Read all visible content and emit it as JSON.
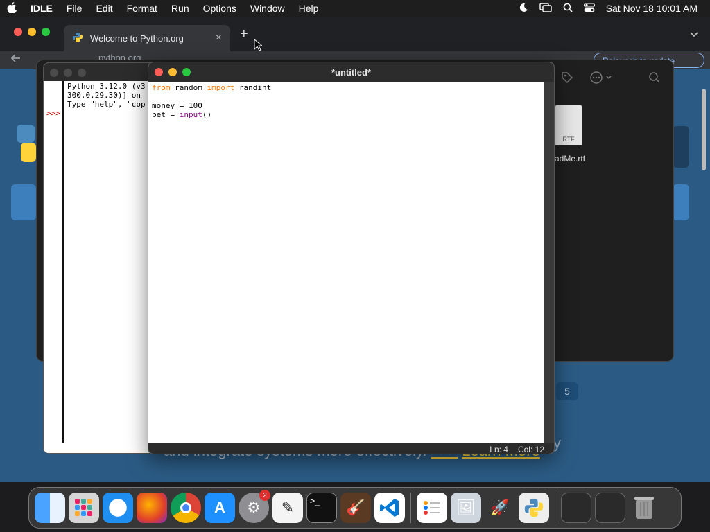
{
  "menubar": {
    "app": "IDLE",
    "items": [
      "File",
      "Edit",
      "Format",
      "Run",
      "Options",
      "Window",
      "Help"
    ],
    "datetime": "Sat Nov 18  10:01 AM"
  },
  "browser": {
    "tab_title": "Welcome to Python.org",
    "close_glyph": "×",
    "new_tab_glyph": "+",
    "url": "python.org",
    "relaunch_label": "Relaunch to update",
    "tagline": "and integrate systems more effectively.",
    "tagline_link": "Learn More",
    "tagline_arrows": ">>>",
    "ghost_text": "y",
    "page_badge": "5"
  },
  "finder": {
    "file_name": "adMe.rtf",
    "file_type": "RTF"
  },
  "shell": {
    "prompt": ">>>",
    "text": "Python 3.12.0 (v3\n300.0.29.30)] on\nType \"help\", \"cop"
  },
  "editor": {
    "title": "*untitled*",
    "code_line1_kw1": "from",
    "code_line1_mid": " random ",
    "code_line1_kw2": "import",
    "code_line1_end": " randint",
    "code_line3": "money = 100",
    "code_line4_start": "bet = ",
    "code_line4_bi": "input",
    "code_line4_end": "()",
    "status_ln": "Ln: 4",
    "status_col": "Col: 12"
  },
  "dock": {
    "settings_badge": "2",
    "icons": [
      "finder-icon",
      "launchpad-icon",
      "safari-icon",
      "firefox-icon",
      "chrome-icon",
      "app-store-icon",
      "system-settings-icon",
      "textedit-icon",
      "terminal-icon",
      "garageband-icon",
      "vscode-icon",
      "reminders-icon",
      "preview-icon",
      "rocket-icon",
      "python-launcher-icon",
      "downloads-folder-icon",
      "screenshots-folder-icon",
      "trash-icon"
    ]
  },
  "colors": {
    "accent_keyword": "#ff7700",
    "builtin": "#900090",
    "prompt": "#cc0000",
    "python_blue": "#2b5b84"
  }
}
